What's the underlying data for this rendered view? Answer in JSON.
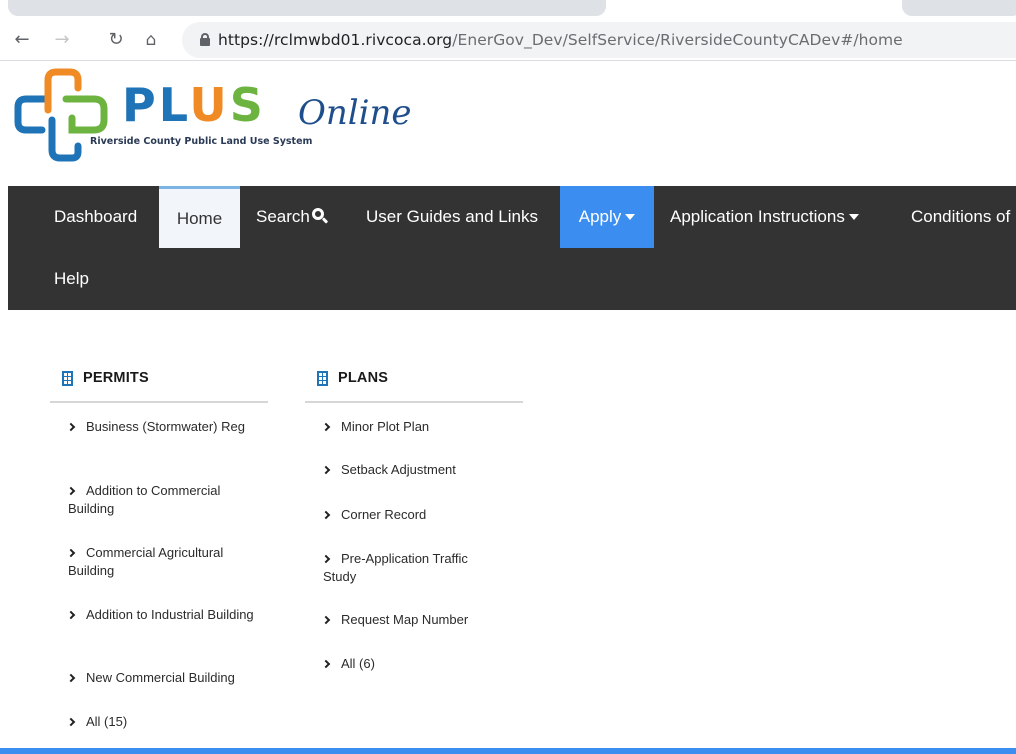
{
  "browser": {
    "url_host": "https://rclmwbd01.rivcoca.org",
    "url_path": "/EnerGov_Dev/SelfService/RiversideCountyCADev#/home",
    "icons": {
      "back": "back-arrow-icon",
      "forward": "forward-arrow-icon",
      "reload": "reload-icon",
      "home": "home-icon",
      "lock": "lock-icon"
    }
  },
  "logo": {
    "plus_pl": "PL",
    "plus_u": "U",
    "plus_s": "S",
    "online": "Online",
    "tagline": "Riverside County Public Land Use System",
    "colors": {
      "blue": "#1f73b7",
      "orange": "#f08a24",
      "green": "#6cb33f",
      "navy": "#1f4e8c"
    }
  },
  "nav": {
    "items": [
      {
        "label": "Dashboard"
      },
      {
        "label": "Home"
      },
      {
        "label": "Search"
      },
      {
        "label": "User Guides and Links"
      },
      {
        "label": "Apply"
      },
      {
        "label": "Application Instructions"
      },
      {
        "label": "Conditions of"
      },
      {
        "label": "Help"
      }
    ],
    "colors": {
      "background": "#333333",
      "active": "#f2f6fb",
      "apply": "#3b8ef0"
    }
  },
  "permits": {
    "title": "PERMITS",
    "items": [
      "Business (Stormwater) Reg",
      "Addition to Commercial Building",
      "Commercial Agricultural Building",
      "Addition to Industrial Building",
      "New Commercial Building",
      "All (15)"
    ]
  },
  "plans": {
    "title": "PLANS",
    "items": [
      "Minor Plot Plan",
      "Setback Adjustment",
      "Corner Record",
      "Pre-Application Traffic Study",
      "Request Map Number",
      "All (6)"
    ]
  }
}
